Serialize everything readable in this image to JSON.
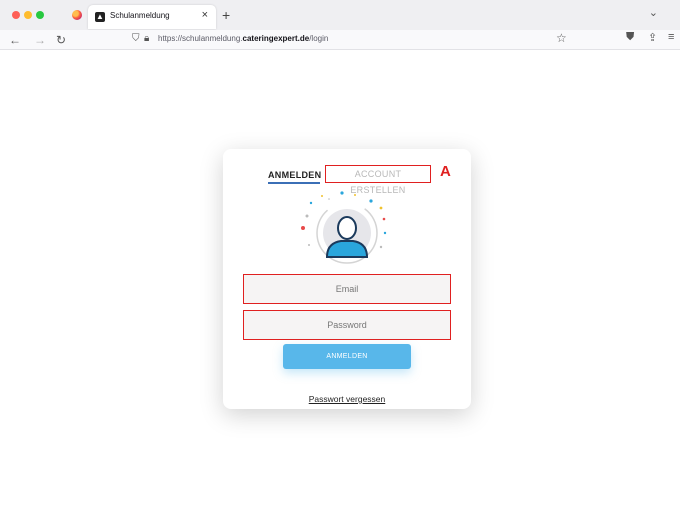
{
  "browser": {
    "tab_title": "Schulanmeldung",
    "tab_close": "×",
    "new_tab": "+",
    "url_prefix": "https://schulanmeldung.",
    "url_domain": "cateringexpert.de",
    "url_path": "/login",
    "icons": [
      "back-icon",
      "forward-icon",
      "reload-icon",
      "shield-icon",
      "lock-icon",
      "star-icon",
      "pocket-icon",
      "share-icon",
      "menu-icon"
    ]
  },
  "login": {
    "tab_login": "ANMELDEN",
    "tab_create": "ACCOUNT ERSTELLEN",
    "marker": "A",
    "email_placeholder": "Email",
    "password_placeholder": "Password",
    "submit": "ANMELDEN",
    "forgot": "Passwort vergessen"
  },
  "colors": {
    "accent": "#58b7ea",
    "highlight": "#e02020",
    "avatar_body": "#2aa6dc"
  }
}
